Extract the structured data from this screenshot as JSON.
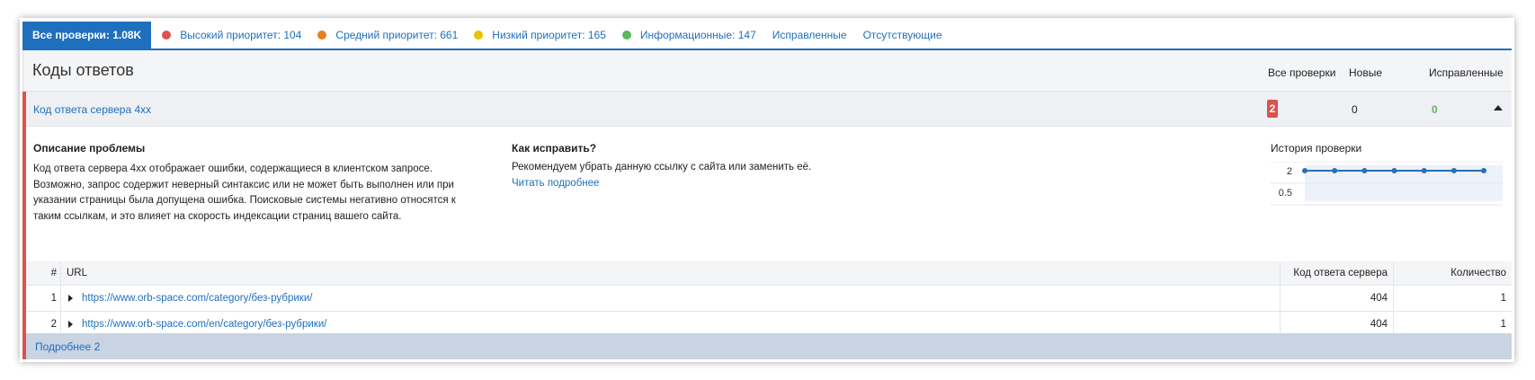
{
  "tabs": [
    {
      "label": "Все проверки: 1.08K",
      "active": true
    },
    {
      "label": "Высокий приоритет: 104",
      "dot": "#d9534f"
    },
    {
      "label": "Средний приоритет: 661",
      "dot": "#e67e22"
    },
    {
      "label": "Низкий приоритет: 165",
      "dot": "#e6c200"
    },
    {
      "label": "Информационные: 147",
      "dot": "#5cb85c"
    },
    {
      "label": "Исправленные"
    },
    {
      "label": "Отсутствующие"
    }
  ],
  "header": {
    "title": "Коды ответов",
    "col_all": "Все проверки",
    "col_new": "Новые",
    "col_fixed": "Исправленные"
  },
  "issue": {
    "title": "Код ответа сервера 4xx",
    "count_all": "2",
    "count_new": "0",
    "count_fixed": "0",
    "problem_title": "Описание проблемы",
    "problem_text": "Код ответа сервера 4xx отображает ошибки, содержащиеся в клиентском запросе. Возможно, запрос содержит неверный синтаксис или не может быть выполнен или при указании страницы была допущена ошибка. Поисковые системы негативно относятся к таким ссылкам, и это влияет на скорость индексации страниц вашего сайта.",
    "fix_title": "Как исправить?",
    "fix_text": "Рекомендуем убрать данную ссылку с сайта или заменить её.",
    "fix_link": "Читать подробнее",
    "history_title": "История проверки",
    "history_y_top": "2",
    "history_y_bottom": "0.5",
    "history_values": [
      2,
      2,
      2,
      2,
      2,
      2,
      2
    ]
  },
  "table": {
    "col_num": "#",
    "col_url": "URL",
    "col_code": "Код ответа сервера",
    "col_qty": "Количество",
    "rows": [
      {
        "num": "1",
        "url": "https://www.orb-space.com/category/без-рубрики/",
        "code": "404",
        "qty": "1"
      },
      {
        "num": "2",
        "url": "https://www.orb-space.com/en/category/без-рубрики/",
        "code": "404",
        "qty": "1"
      }
    ]
  },
  "more_label": "Подробнее 2",
  "colors": {
    "accent": "#1f6fbf",
    "danger": "#d9534f",
    "success": "#5cb85c"
  }
}
